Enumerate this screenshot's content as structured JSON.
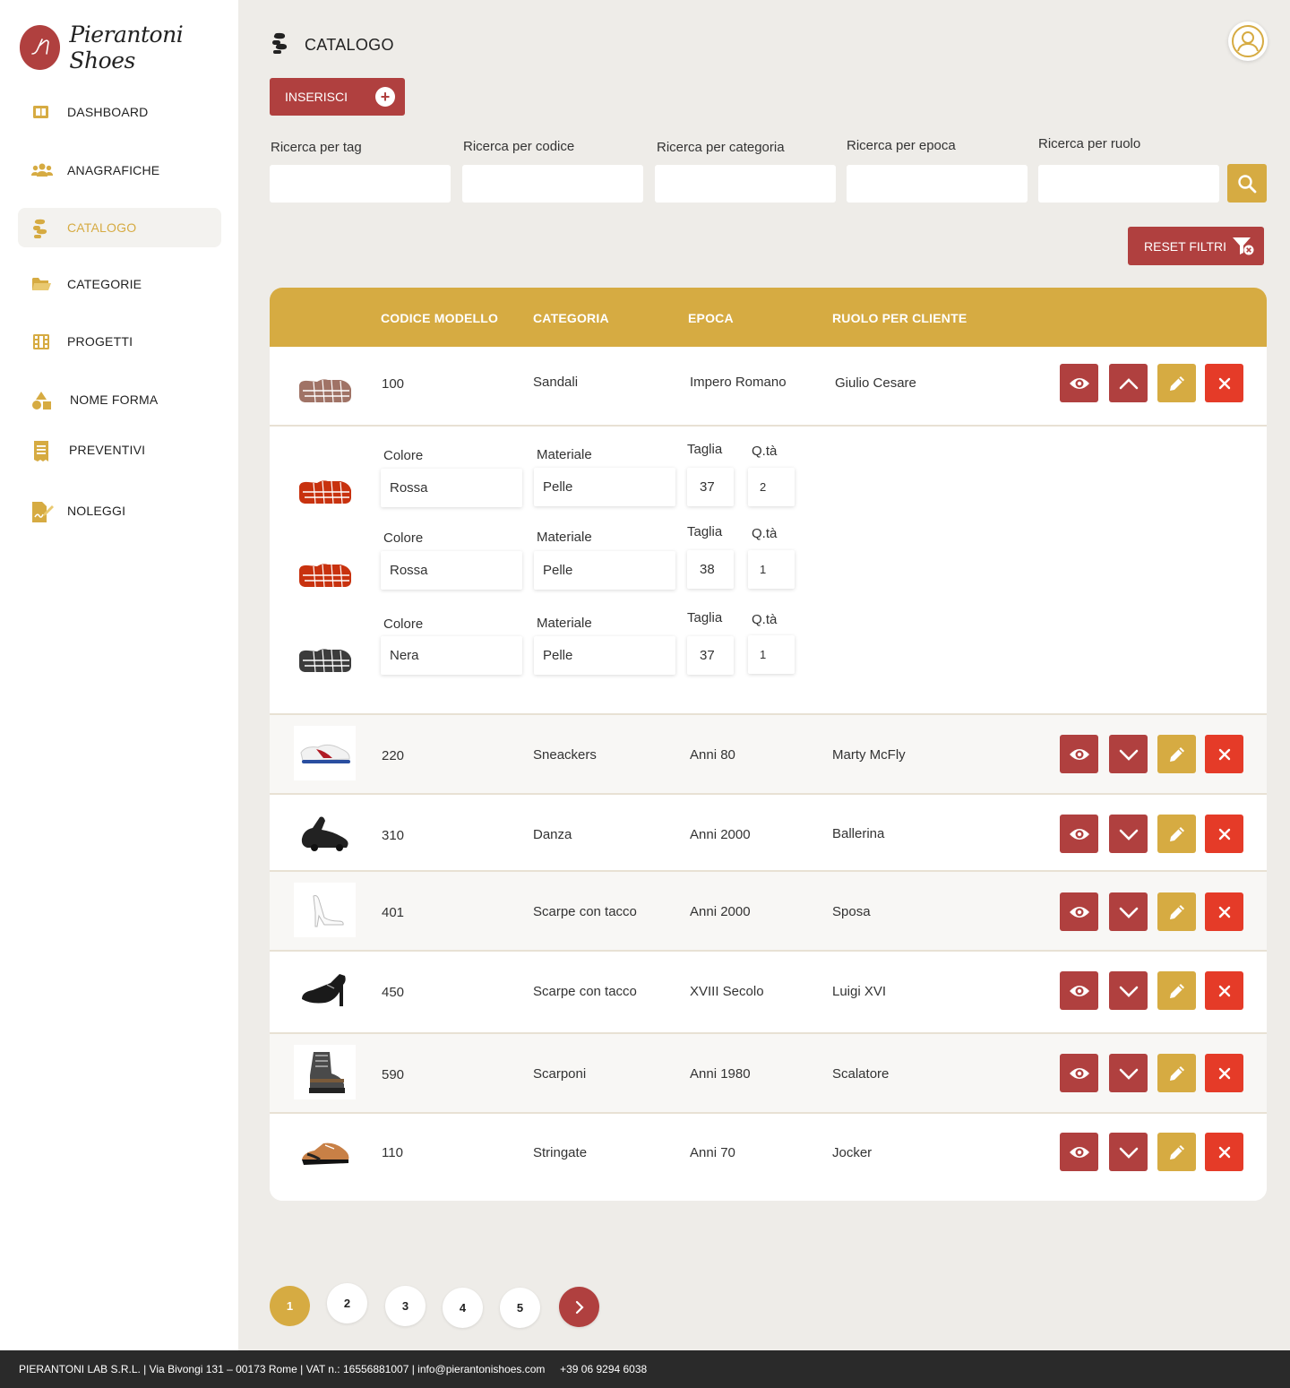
{
  "brand": {
    "name": "Pierantoni Shoes"
  },
  "sidebar": {
    "items": [
      {
        "label": "DASHBOARD",
        "icon": "dashboard-icon"
      },
      {
        "label": "ANAGRAFICHE",
        "icon": "users-icon"
      },
      {
        "label": "CATALOGO",
        "icon": "footprints-icon",
        "active": true
      },
      {
        "label": "CATEGORIE",
        "icon": "folder-icon"
      },
      {
        "label": "PROGETTI",
        "icon": "film-icon"
      },
      {
        "label": "NOME FORMA",
        "icon": "shapes-icon"
      },
      {
        "label": "PREVENTIVI",
        "icon": "receipt-icon"
      },
      {
        "label": "NOLEGGI",
        "icon": "file-signature-icon"
      }
    ]
  },
  "header": {
    "title": "CATALOGO",
    "insert_label": "INSERISCI"
  },
  "filters": {
    "tag": "Ricerca per tag",
    "codice": "Ricerca per codice",
    "categoria": "Ricerca per categoria",
    "epoca": "Ricerca per epoca",
    "ruolo": "Ricerca per ruolo",
    "reset_label": "RESET FILTRI"
  },
  "table": {
    "headers": {
      "codice": "CODICE MODELLO",
      "categoria": "CATEGORIA",
      "epoca": "EPOCA",
      "ruolo": "RUOLO PER CLIENTE"
    },
    "rows": [
      {
        "codice": "100",
        "categoria": "Sandali",
        "epoca": "Impero Romano",
        "ruolo": "Giulio Cesare",
        "expanded": true
      },
      {
        "codice": "220",
        "categoria": "Sneackers",
        "epoca": "Anni 80",
        "ruolo": "Marty McFly"
      },
      {
        "codice": "310",
        "categoria": "Danza",
        "epoca": "Anni 2000",
        "ruolo": "Ballerina"
      },
      {
        "codice": "401",
        "categoria": "Scarpe con tacco",
        "epoca": "Anni 2000",
        "ruolo": "Sposa"
      },
      {
        "codice": "450",
        "categoria": "Scarpe con tacco",
        "epoca": "XVIII Secolo",
        "ruolo": "Luigi XVI"
      },
      {
        "codice": "590",
        "categoria": "Scarponi",
        "epoca": "Anni 1980",
        "ruolo": "Scalatore"
      },
      {
        "codice": "110",
        "categoria": "Stringate",
        "epoca": "Anni 70",
        "ruolo": "Jocker"
      }
    ],
    "variant_labels": {
      "colore": "Colore",
      "materiale": "Materiale",
      "taglia": "Taglia",
      "qta": "Q.tà"
    },
    "variants": [
      {
        "colore": "Rossa",
        "materiale": "Pelle",
        "taglia": "37",
        "qta": "2"
      },
      {
        "colore": "Rossa",
        "materiale": "Pelle",
        "taglia": "38",
        "qta": "1"
      },
      {
        "colore": "Nera",
        "materiale": "Pelle",
        "taglia": "37",
        "qta": "1"
      }
    ]
  },
  "pagination": {
    "pages": [
      "1",
      "2",
      "3",
      "4",
      "5"
    ],
    "current": "1"
  },
  "footer": {
    "text": "PIERANTONI LAB S.R.L. | Via Bivongi 131 – 00173 Rome | VAT n.: 16556881007 | info@pierantonishoes.com     +39 06 9294 6038"
  },
  "colors": {
    "accent": "#d6ab42",
    "primary": "#b0403f",
    "danger": "#e53b28",
    "background": "#eeece8"
  }
}
